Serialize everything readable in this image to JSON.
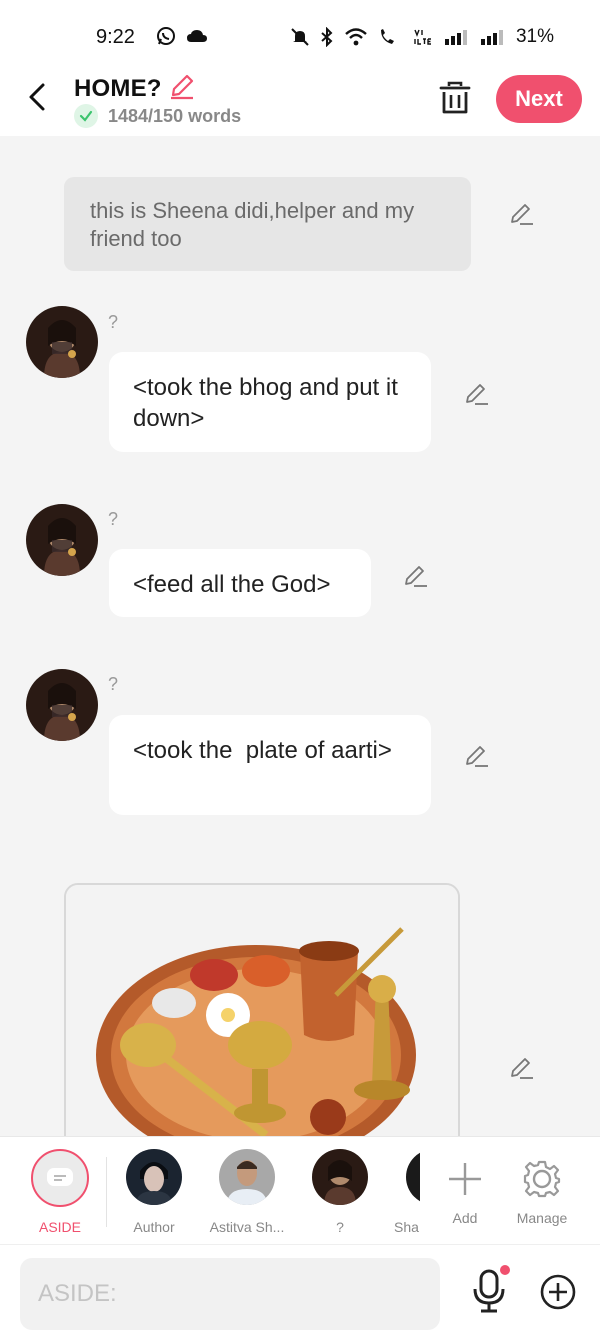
{
  "status_bar": {
    "time": "9:22",
    "battery": "31%"
  },
  "header": {
    "title": "HOME?",
    "word_count": "1484/150 words",
    "next_label": "Next"
  },
  "messages": {
    "narration": "this is Sheena didi,helper and my friend too",
    "m1": {
      "speaker": "?",
      "text": "<took the bhog and put it down>"
    },
    "m2": {
      "speaker": "?",
      "text": "<feed all the God>"
    },
    "m3": {
      "speaker": "?",
      "text": "<took the  plate of aarti>"
    }
  },
  "characters": {
    "aside": "ASIDE",
    "author": "Author",
    "astitva": "Astitva Sh...",
    "unknown": "?",
    "sha": "Sha",
    "add": "Add",
    "manage": "Manage"
  },
  "input": {
    "placeholder": "ASIDE:"
  },
  "colors": {
    "accent": "#f0506e",
    "chat_bg": "#f4f4f4",
    "check_green": "#3cc46e"
  }
}
